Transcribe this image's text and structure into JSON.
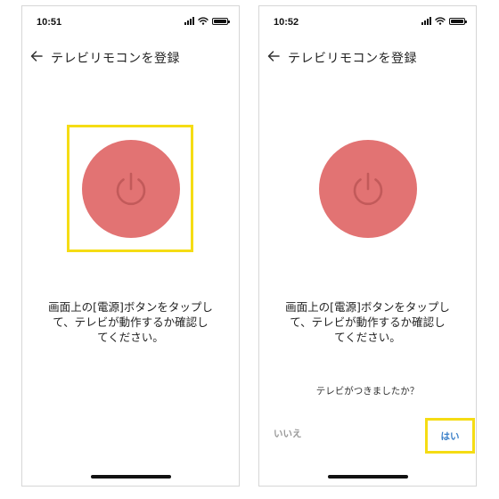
{
  "screens": [
    {
      "time": "10:51",
      "header_title": "テレビリモコンを登録",
      "instruction_lines": [
        "画面上の[電源]ボタンをタップし",
        "て、テレビが動作するか確認し",
        "てください。"
      ]
    },
    {
      "time": "10:52",
      "header_title": "テレビリモコンを登録",
      "instruction_lines": [
        "画面上の[電源]ボタンをタップし",
        "て、テレビが動作するか確認し",
        "てください。"
      ],
      "question": "テレビがつきましたか？",
      "no_label": "いいえ",
      "yes_label": "はい"
    }
  ],
  "colors": {
    "power_button": "#e27373",
    "power_icon": "#c25a5a",
    "highlight": "#f5dc14",
    "yes_text": "#3a7fc8",
    "no_text": "#9a9a9a"
  },
  "icons": {
    "back": "arrow-left",
    "power": "power-symbol",
    "signal": "cellular-signal",
    "wifi": "wifi",
    "battery": "battery"
  }
}
